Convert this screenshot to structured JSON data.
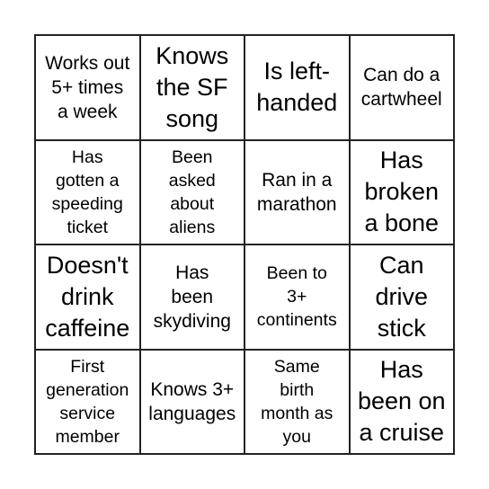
{
  "card": {
    "cells": [
      "Works out\n5+ times\na week",
      "Knows\nthe SF\nsong",
      "Is left-\nhanded",
      "Can do a\ncartwheel",
      "Has\ngotten a\nspeeding\nticket",
      "Been\nasked\nabout\naliens",
      "Ran in a\nmarathon",
      "Has\nbroken\na bone",
      "Doesn't\ndrink\ncaffeine",
      "Has\nbeen\nskydiving",
      "Been to\n3+\ncontinents",
      "Can\ndrive\nstick",
      "First\ngeneration\nservice\nmember",
      "Knows 3+\nlanguages",
      "Same\nbirth\nmonth as\nyou",
      "Has\nbeen on\na cruise"
    ]
  }
}
